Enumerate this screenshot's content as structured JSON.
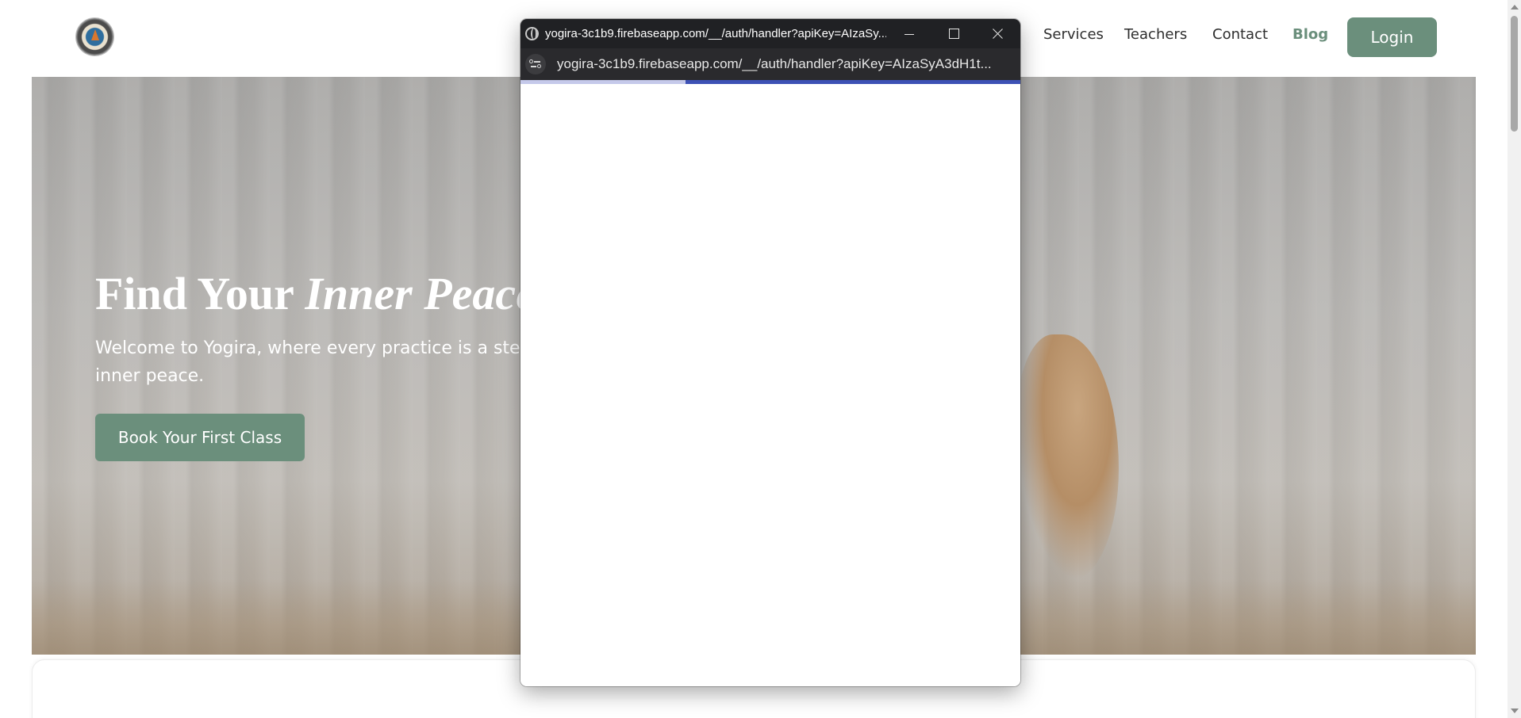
{
  "nav": {
    "links": [
      "Services",
      "Teachers",
      "Contact",
      "Blog"
    ],
    "login_label": "Login"
  },
  "hero": {
    "title_plain": "Find Your ",
    "title_italic": "Inner Peace",
    "subtitle": "Welcome to Yogira, where every practice is a step toward inner peace.",
    "cta_label": "Book Your First Class"
  },
  "popup": {
    "title": "yogira-3c1b9.firebaseapp.com/__/auth/handler?apiKey=AIzaSy...",
    "url": "yogira-3c1b9.firebaseapp.com/__/auth/handler?apiKey=AIzaSyA3dH1t...",
    "load_progress_pct": 33
  },
  "colors": {
    "brand": "#6b8f7c",
    "popup_chrome": "#202124",
    "progress": "#3d51b5"
  },
  "icons": {
    "logo": "yoga-logo-icon",
    "popup_site": "globe-icon",
    "address_info": "site-info-icon",
    "minimize": "minimize-icon",
    "maximize": "maximize-icon",
    "close": "close-icon"
  }
}
